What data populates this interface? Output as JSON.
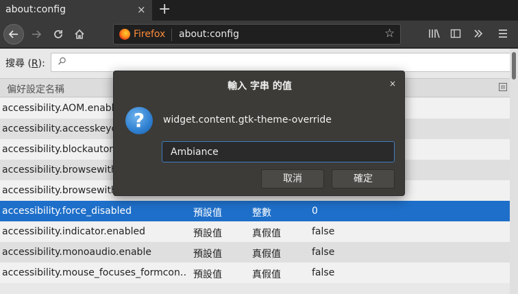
{
  "tab": {
    "title": "about:config",
    "close": "×",
    "new_tab": "+"
  },
  "urlbar": {
    "identity_label": "Firefox",
    "url": "about:config"
  },
  "search": {
    "label_prefix": "搜尋 (",
    "label_key": "R",
    "label_suffix": "):",
    "value": ""
  },
  "columns": {
    "name": "偏好設定名稱"
  },
  "rows": [
    {
      "name": "accessibility.AOM.enabled",
      "status": "",
      "type": "",
      "value": ""
    },
    {
      "name": "accessibility.accesskeycausesactivation",
      "status": "",
      "type": "",
      "value": ""
    },
    {
      "name": "accessibility.blockautorefresh",
      "status": "",
      "type": "",
      "value": ""
    },
    {
      "name": "accessibility.browsewithcaret",
      "status": "",
      "type": "",
      "value": ""
    },
    {
      "name": "accessibility.browsewithcaret_shortcut.enabled",
      "status": "",
      "type": "",
      "value": ""
    },
    {
      "name": "accessibility.force_disabled",
      "status": "預設值",
      "type": "整數",
      "value": "0",
      "selected": true
    },
    {
      "name": "accessibility.indicator.enabled",
      "status": "預設值",
      "type": "真假值",
      "value": "false"
    },
    {
      "name": "accessibility.monoaudio.enable",
      "status": "預設值",
      "type": "真假值",
      "value": "false"
    },
    {
      "name": "accessibility.mouse_focuses_formcon…",
      "status": "預設值",
      "type": "真假值",
      "value": "false"
    }
  ],
  "dialog": {
    "title": "輸入 字串 的值",
    "close": "×",
    "icon": "?",
    "pref_name": "widget.content.gtk-theme-override",
    "input_value": "Ambiance",
    "cancel_label": "取消",
    "ok_label": "確定"
  },
  "colors": {
    "selection": "#1e6fc9",
    "dialog_bg": "#3c3b37",
    "firefox_orange": "#ff8c3a"
  }
}
